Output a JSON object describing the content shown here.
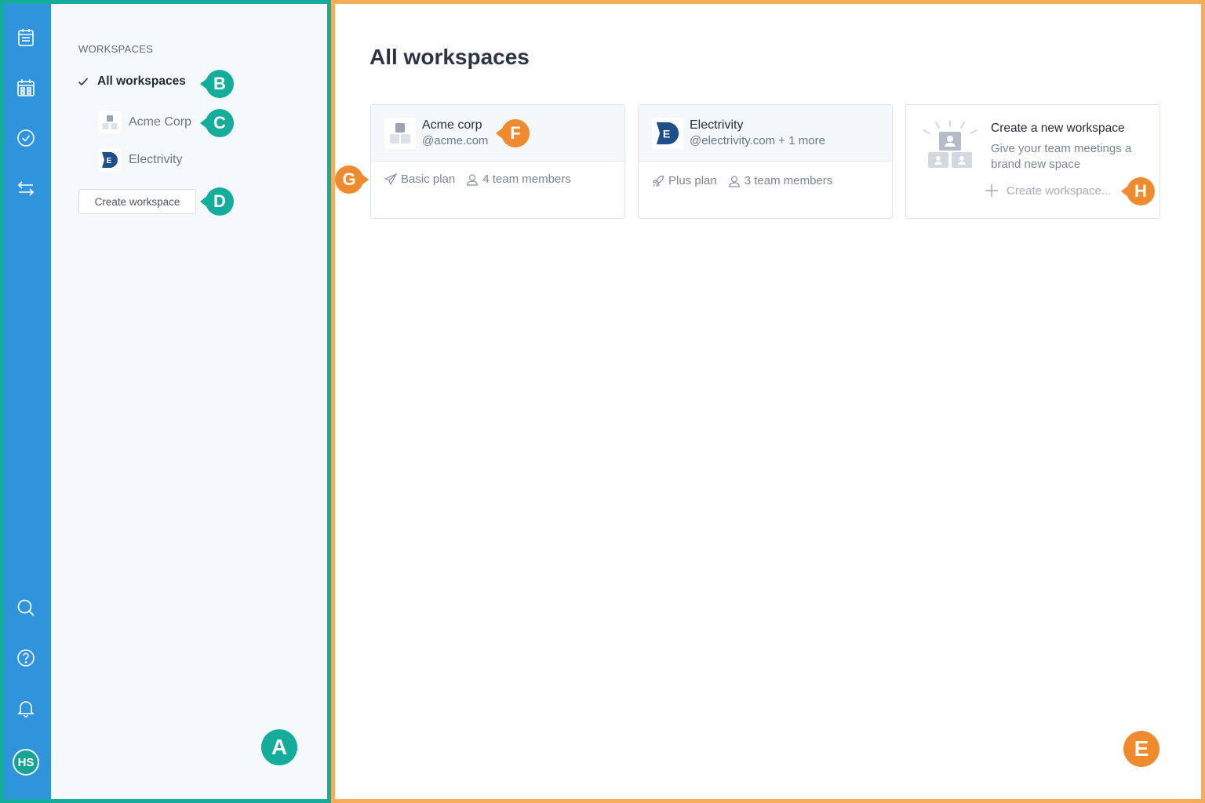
{
  "rail": {
    "icons": [
      "notes-icon",
      "calendar-icon",
      "check-circle-icon",
      "swap-arrows-icon",
      "search-icon",
      "help-icon",
      "bell-icon"
    ],
    "avatar_initials": "HS",
    "color": "#2f94dc"
  },
  "sidebar": {
    "heading": "WORKSPACES",
    "items": [
      {
        "label": "All workspaces",
        "active": true
      },
      {
        "label": "Acme Corp",
        "active": false
      },
      {
        "label": "Electrivity",
        "active": false
      }
    ],
    "create_button": "Create workspace"
  },
  "main": {
    "title": "All workspaces",
    "cards": [
      {
        "name": "Acme corp",
        "domain": "@acme.com",
        "plan": "Basic plan",
        "members": "4 team members"
      },
      {
        "name": "Electrivity",
        "domain": "@electrivity.com + 1 more",
        "plan": "Plus plan",
        "members": "3 team members"
      }
    ],
    "new_workspace": {
      "title": "Create a new workspace",
      "description": "Give your team meetings a brand new space",
      "link": "Create workspace..."
    }
  },
  "annotations": {
    "A": "A",
    "B": "B",
    "C": "C",
    "D": "D",
    "E": "E",
    "F": "F",
    "G": "G",
    "H": "H"
  },
  "colors": {
    "teal": "#14ad9c",
    "orange": "#ef8a2e",
    "frame_orange": "#f5ad5b",
    "electrivity_brand": "#1d4f8a"
  }
}
